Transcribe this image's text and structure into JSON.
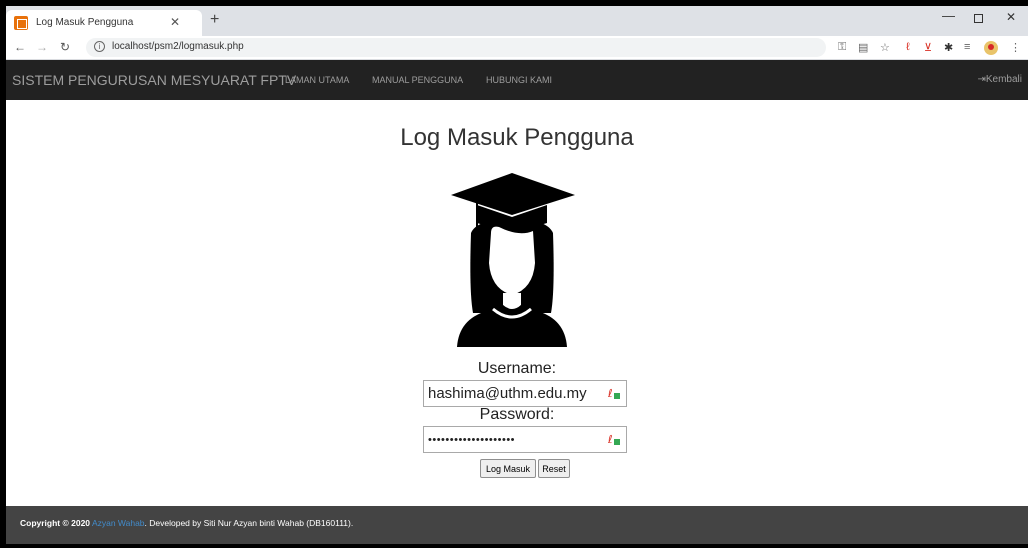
{
  "browser": {
    "tab_title": "Log Masuk Pengguna",
    "url": "localhost/psm2/logmasuk.php"
  },
  "navbar": {
    "brand": "SISTEM PENGURUSAN MESYUARAT FPTV",
    "links": [
      "LAMAN UTAMA",
      "MANUAL PENGGUNA",
      "HUBUNGI KAMI"
    ],
    "back_label": "Kembali"
  },
  "login": {
    "title": "Log Masuk Pengguna",
    "username_label": "Username:",
    "username_value": "hashima@uthm.edu.my",
    "password_label": "Password:",
    "password_value": "••••••••••••••••••••",
    "submit_label": "Log Masuk",
    "reset_label": "Reset"
  },
  "footer": {
    "copyright": "Copyright © 2020",
    "author": "Azyan Wahab",
    "credit": ". Developed by Siti Nur Azyan binti Wahab (DB160111)."
  },
  "colors": {
    "navbar_bg": "#222222",
    "footer_bg": "#444444",
    "link_accent": "#428bca"
  }
}
